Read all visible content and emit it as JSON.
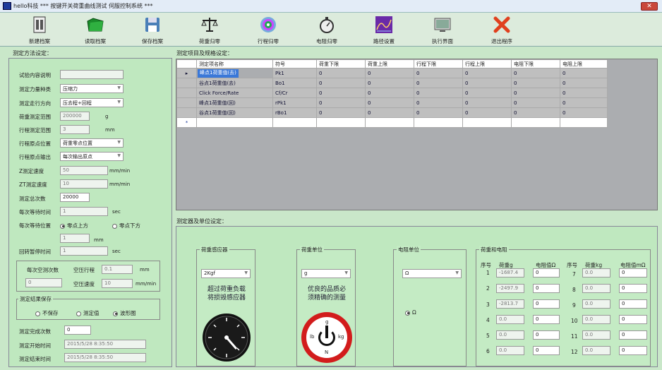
{
  "window": {
    "title": "hello科技    *** 按键开关荷重曲线测试 伺服控制系统 ***",
    "close_label": "✕"
  },
  "toolbar": [
    {
      "label": "新建档案",
      "icon": "new-file-icon"
    },
    {
      "label": "读取档案",
      "icon": "open-folder-icon"
    },
    {
      "label": "保存档案",
      "icon": "save-icon"
    },
    {
      "label": "荷重归零",
      "icon": "balance-icon"
    },
    {
      "label": "行程归零",
      "icon": "stroke-zero-icon"
    },
    {
      "label": "电阻归零",
      "icon": "stopwatch-icon"
    },
    {
      "label": "路径设置",
      "icon": "path-chart-icon"
    },
    {
      "label": "执行界面",
      "icon": "monitor-icon"
    },
    {
      "label": "退出程序",
      "icon": "exit-icon"
    }
  ],
  "method": {
    "title": "测定方法设定：",
    "fields": {
      "desc": {
        "label": "试验内容说明",
        "value": ""
      },
      "force_type": {
        "label": "测定力量种类",
        "value": "压缩力"
      },
      "direction": {
        "label": "测定走行方向",
        "value": "压去程+回程"
      },
      "load_range": {
        "label": "荷重测定范围",
        "value": "200000",
        "unit": "g"
      },
      "stroke_range": {
        "label": "行程测定范围",
        "value": "3",
        "unit": "mm"
      },
      "origin_pos": {
        "label": "行程原点位置",
        "value": "荷重零点位置"
      },
      "origin_out": {
        "label": "行程原点输出",
        "value": "每次输出原点"
      },
      "z_speed": {
        "label": "Z测定速度",
        "value": "50",
        "unit": "mm/min"
      },
      "zt_speed": {
        "label": "ZT测定速度",
        "value": "10",
        "unit": "mm/min"
      },
      "total": {
        "label": "测定总次数",
        "value": "20000"
      },
      "wait_time": {
        "label": "每次等待时间",
        "value": "1",
        "unit": "sec"
      },
      "wait_pos": {
        "label": "每次等待位置",
        "opt1": "零点上方",
        "opt2": "零点下方"
      },
      "wait_mm": {
        "value": "1",
        "unit": "mm"
      },
      "return_time": {
        "label": "回转暂停时间",
        "value": "1",
        "unit": "sec"
      }
    },
    "empty_run": {
      "label": "每次空测次数",
      "count": "0",
      "stroke_label": "空压行程",
      "stroke_value": "0.1",
      "stroke_unit": "mm",
      "speed_label": "空压速度",
      "speed_value": "10",
      "speed_unit": "mm/min"
    },
    "save": {
      "label": "测定结果保存",
      "opt1": "不保存",
      "opt2": "测定值",
      "opt3": "波形图"
    },
    "done_count": {
      "label": "测定完成次数",
      "value": "0"
    },
    "start_time": {
      "label": "测定开始时间",
      "value": "2015/5/28 8:35:50"
    },
    "end_time": {
      "label": "测定结束时间",
      "value": "2015/5/28 8:35:50"
    }
  },
  "spec": {
    "title": "测定项目及规格设定：",
    "columns": [
      "测定项名称",
      "符号",
      "荷重下限",
      "荷重上限",
      "行程下限",
      "行程上限",
      "电阻下限",
      "电阻上限"
    ],
    "rows": [
      [
        "峰点1荷重值(去)",
        "Pk1",
        "0",
        "0",
        "0",
        "0",
        "0",
        "0"
      ],
      [
        "谷点1荷重值(去)",
        "Bo1",
        "0",
        "0",
        "0",
        "0",
        "0",
        "0"
      ],
      [
        "Click Force/Rate",
        "Cf/Cr",
        "0",
        "0",
        "0",
        "0",
        "0",
        "0"
      ],
      [
        "峰点1荷重值(回)",
        "rPk1",
        "0",
        "0",
        "0",
        "0",
        "0",
        "0"
      ],
      [
        "谷点1荷重值(回)",
        "rBo1",
        "0",
        "0",
        "0",
        "0",
        "0",
        "0"
      ]
    ],
    "current_marker": "▸",
    "new_marker": "*"
  },
  "units": {
    "title": "测定器及单位设定：",
    "sensor": {
      "title": "荷重感应器",
      "value": "2Kgf",
      "warn1": "超过荷重负载",
      "warn2": "将损毁感应器"
    },
    "load_unit": {
      "title": "荷重单位",
      "value": "g",
      "warn1": "优良的品质必",
      "warn2": "须精确的测量",
      "dial_top": "g",
      "dial_left": "lb",
      "dial_right": "kg",
      "dial_bottom": "N"
    },
    "res_unit": {
      "title": "电阻单位",
      "value": "Ω",
      "radio": "Ω"
    },
    "cal": {
      "title": "荷重和电阻",
      "headers": [
        "序号",
        "荷重g",
        "电阻值Ω",
        "序号",
        "荷重kg",
        "电阻值mΩ"
      ],
      "rows": [
        [
          "1",
          "-1687.4",
          "0",
          "7",
          "0.0",
          "0"
        ],
        [
          "2",
          "-2497.9",
          "0",
          "8",
          "0.0",
          "0"
        ],
        [
          "3",
          "-2813.7",
          "0",
          "9",
          "0.0",
          "0"
        ],
        [
          "4",
          "0.0",
          "0",
          "10",
          "0.0",
          "0"
        ],
        [
          "5",
          "0.0",
          "0",
          "11",
          "0.0",
          "0"
        ],
        [
          "6",
          "0.0",
          "0",
          "12",
          "0.0",
          "0"
        ]
      ]
    }
  },
  "colors": {
    "accent": "#3a78d8",
    "panel": "#bfe8bf",
    "exit": "#e0401e"
  }
}
